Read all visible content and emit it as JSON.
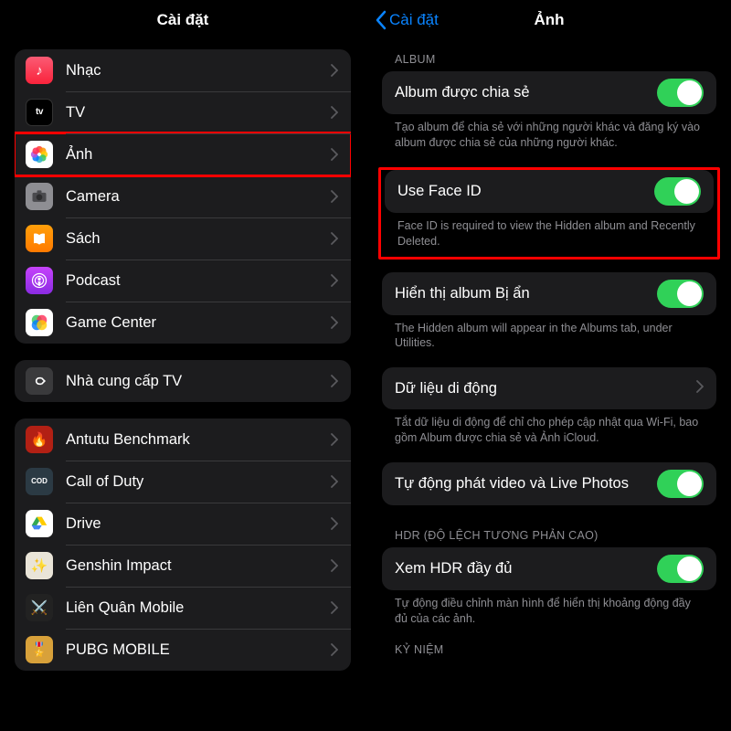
{
  "left": {
    "title": "Cài đặt",
    "group1": [
      {
        "id": "music",
        "label": "Nhạc",
        "icon": "music-icon"
      },
      {
        "id": "tv",
        "label": "TV",
        "icon": "tv-icon"
      },
      {
        "id": "photos",
        "label": "Ảnh",
        "icon": "photos-icon",
        "highlighted": true
      },
      {
        "id": "camera",
        "label": "Camera",
        "icon": "camera-icon"
      },
      {
        "id": "books",
        "label": "Sách",
        "icon": "books-icon"
      },
      {
        "id": "podcast",
        "label": "Podcast",
        "icon": "podcast-icon"
      },
      {
        "id": "gamecenter",
        "label": "Game Center",
        "icon": "gamecenter-icon"
      }
    ],
    "group2": [
      {
        "id": "tvprovider",
        "label": "Nhà cung cấp TV",
        "icon": "tvprovider-icon"
      }
    ],
    "group3": [
      {
        "id": "antutu",
        "label": "Antutu Benchmark",
        "icon": "antutu-icon"
      },
      {
        "id": "cod",
        "label": "Call of Duty",
        "icon": "cod-icon"
      },
      {
        "id": "drive",
        "label": "Drive",
        "icon": "drive-icon"
      },
      {
        "id": "genshin",
        "label": "Genshin Impact",
        "icon": "genshin-icon"
      },
      {
        "id": "lq",
        "label": "Liên Quân Mobile",
        "icon": "lq-icon"
      },
      {
        "id": "pubg",
        "label": "PUBG MOBILE",
        "icon": "pubg-icon"
      }
    ]
  },
  "right": {
    "back_label": "Cài đặt",
    "title": "Ảnh",
    "section_album_header": "ALBUM",
    "shared_album_label": "Album được chia sẻ",
    "shared_album_on": true,
    "shared_album_note": "Tạo album để chia sẻ với những người khác và đăng ký vào album được chia sẻ của những người khác.",
    "faceid_label": "Use Face ID",
    "faceid_on": true,
    "faceid_note": "Face ID is required to view the Hidden album and Recently Deleted.",
    "hidden_label": "Hiển thị album Bị ẩn",
    "hidden_on": true,
    "hidden_note": "The Hidden album will appear in the Albums tab, under Utilities.",
    "cellular_label": "Dữ liệu di động",
    "cellular_note": "Tắt dữ liệu di động để chỉ cho phép cập nhật qua Wi-Fi, bao gồm Album được chia sẻ và Ảnh iCloud.",
    "autoplay_label": "Tự động phát video và Live Photos",
    "autoplay_on": true,
    "section_hdr_header": "HDR (ĐỘ LỆCH TƯƠNG PHẢN CAO)",
    "hdr_label": "Xem HDR đầy đủ",
    "hdr_on": true,
    "hdr_note": "Tự động điều chỉnh màn hình để hiển thị khoảng động đầy đủ của các ảnh.",
    "section_memories_header": "KỶ NIỆM"
  }
}
